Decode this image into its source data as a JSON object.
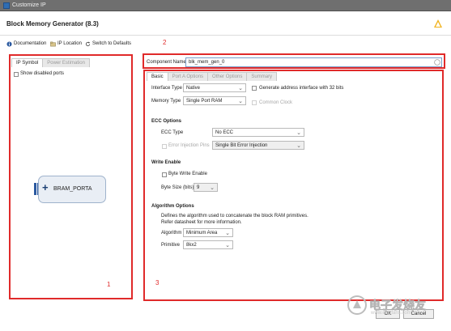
{
  "window": {
    "title": "Customize IP"
  },
  "header": {
    "title": "Block Memory Generator (8.3)"
  },
  "toolbar": {
    "documentation": "Documentation",
    "ip_location": "IP Location",
    "switch_defaults": "Switch to Defaults"
  },
  "left_panel": {
    "tabs": [
      "IP Symbol",
      "Power Estimation"
    ],
    "active_tab": "IP Symbol",
    "show_disabled_ports": {
      "label": "Show disabled ports",
      "checked": false
    },
    "symbol": {
      "port_label": "BRAM_PORTA"
    }
  },
  "component": {
    "label": "Component Name",
    "value": "blk_mem_gen_0"
  },
  "right_panel": {
    "tabs": [
      "Basic",
      "Port A Options",
      "Other Options",
      "Summary"
    ],
    "active_tab": "Basic",
    "interface_type": {
      "label": "Interface Type",
      "value": "Native"
    },
    "memory_type": {
      "label": "Memory Type",
      "value": "Single Port RAM"
    },
    "gen_address": {
      "label": "Generate address interface with 32 bits",
      "checked": false
    },
    "common_clock": {
      "label": "Common Clock",
      "checked": false
    },
    "ecc": {
      "title": "ECC Options",
      "type_label": "ECC Type",
      "type_value": "No ECC",
      "error_label": "Error Injection Pins",
      "error_value": "Single Bit Error Injection"
    },
    "write_enable": {
      "title": "Write Enable",
      "byte_we_label": "Byte Write Enable",
      "byte_size_label": "Byte Size (bits)",
      "byte_size_value": "9"
    },
    "algorithm": {
      "title": "Algorithm Options",
      "desc1": "Defines the algorithm used to concatenate the block RAM primitives.",
      "desc2": "Refer datasheet for more information.",
      "algo_label": "Algorithm",
      "algo_value": "Minimum Area",
      "prim_label": "Primitive",
      "prim_value": "8kx2"
    }
  },
  "markers": {
    "m1": "1",
    "m2": "2",
    "m3": "3"
  },
  "buttons": {
    "ok": "OK",
    "cancel": "Cancel"
  },
  "watermark": {
    "text": "电子发烧友",
    "sub": "www.elecfans.com"
  },
  "colors": {
    "highlight": "#e02a2a",
    "brand": "#2c5aa0"
  }
}
